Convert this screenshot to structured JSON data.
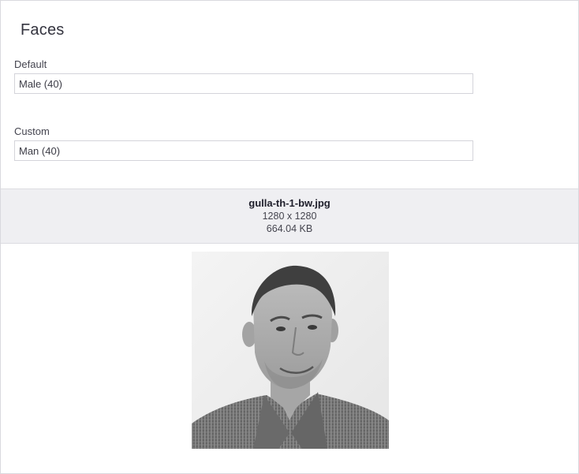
{
  "panel": {
    "title": "Faces"
  },
  "fields": {
    "default": {
      "label": "Default",
      "value": "Male (40)"
    },
    "custom": {
      "label": "Custom",
      "value": "Man (40)"
    }
  },
  "file": {
    "name": "gulla-th-1-bw.jpg",
    "dimensions": "1280 x 1280",
    "size": "664.04 KB"
  },
  "image": {
    "subject": "portrait-photo",
    "style": "grayscale",
    "alt": ""
  }
}
